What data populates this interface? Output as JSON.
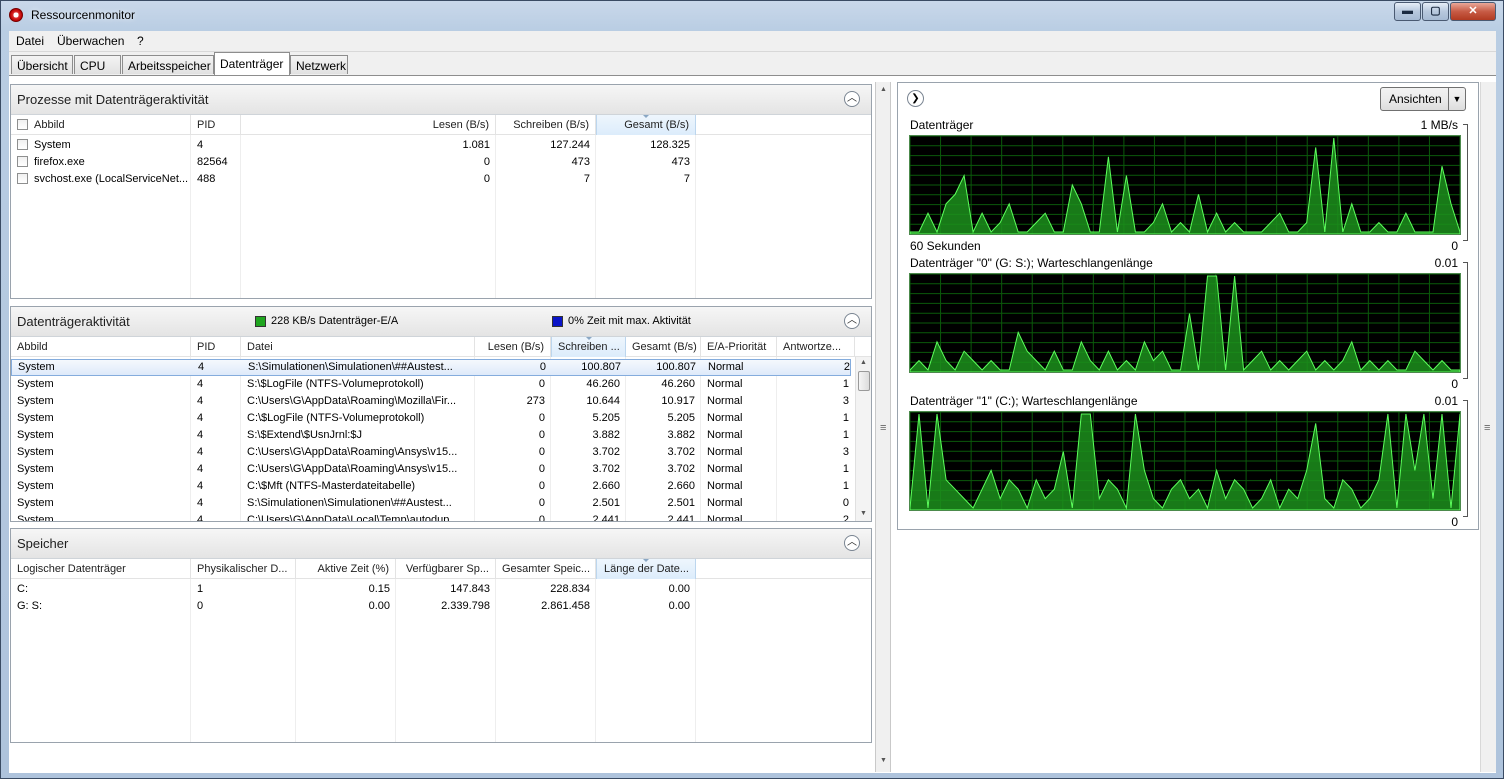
{
  "window": {
    "title": "Ressourcenmonitor",
    "min": "▬",
    "max": "▢",
    "close": "✕"
  },
  "menu": [
    "Datei",
    "Überwachen",
    "?"
  ],
  "tabs": [
    "Übersicht",
    "CPU",
    "Arbeitsspeicher",
    "Datenträger",
    "Netzwerk"
  ],
  "processes": {
    "title": "Prozesse mit Datenträgeraktivität",
    "columns": [
      "Abbild",
      "PID",
      "Lesen (B/s)",
      "Schreiben (B/s)",
      "Gesamt (B/s)"
    ],
    "rows": [
      [
        "System",
        "4",
        "1.081",
        "127.244",
        "128.325"
      ],
      [
        "firefox.exe",
        "82564",
        "0",
        "473",
        "473"
      ],
      [
        "svchost.exe (LocalServiceNet...",
        "488",
        "0",
        "7",
        "7"
      ]
    ]
  },
  "activity": {
    "title": "Datenträgeraktivität",
    "legend1": "228 KB/s Datenträger-E/A",
    "legend2": "0% Zeit mit max. Aktivität",
    "legend1_color": "#1fa51f",
    "legend2_color": "#0a14c8",
    "columns": [
      "Abbild",
      "PID",
      "Datei",
      "Lesen (B/s)",
      "Schreiben ...",
      "Gesamt (B/s)",
      "E/A-Priorität",
      "Antwortze..."
    ],
    "rows": [
      [
        "System",
        "4",
        "S:\\Simulationen\\Simulationen\\##Austest...",
        "0",
        "100.807",
        "100.807",
        "Normal",
        "2"
      ],
      [
        "System",
        "4",
        "S:\\$LogFile (NTFS-Volumeprotokoll)",
        "0",
        "46.260",
        "46.260",
        "Normal",
        "1"
      ],
      [
        "System",
        "4",
        "C:\\Users\\G\\AppData\\Roaming\\Mozilla\\Fir...",
        "273",
        "10.644",
        "10.917",
        "Normal",
        "3"
      ],
      [
        "System",
        "4",
        "C:\\$LogFile (NTFS-Volumeprotokoll)",
        "0",
        "5.205",
        "5.205",
        "Normal",
        "1"
      ],
      [
        "System",
        "4",
        "S:\\$Extend\\$UsnJrnl:$J",
        "0",
        "3.882",
        "3.882",
        "Normal",
        "1"
      ],
      [
        "System",
        "4",
        "C:\\Users\\G\\AppData\\Roaming\\Ansys\\v15...",
        "0",
        "3.702",
        "3.702",
        "Normal",
        "3"
      ],
      [
        "System",
        "4",
        "C:\\Users\\G\\AppData\\Roaming\\Ansys\\v15...",
        "0",
        "3.702",
        "3.702",
        "Normal",
        "1"
      ],
      [
        "System",
        "4",
        "C:\\$Mft (NTFS-Masterdateitabelle)",
        "0",
        "2.660",
        "2.660",
        "Normal",
        "1"
      ],
      [
        "System",
        "4",
        "S:\\Simulationen\\Simulationen\\##Austest...",
        "0",
        "2.501",
        "2.501",
        "Normal",
        "0"
      ],
      [
        "System",
        "4",
        "C:\\Users\\G\\AppData\\Local\\Temp\\autodup...",
        "0",
        "2.441",
        "2.441",
        "Normal",
        "2"
      ]
    ]
  },
  "storage": {
    "title": "Speicher",
    "columns": [
      "Logischer Datenträger",
      "Physikalischer D...",
      "Aktive Zeit (%)",
      "Verfügbarer Sp...",
      "Gesamter Speic...",
      "Länge der Date..."
    ],
    "rows": [
      [
        "C:",
        "1",
        "0.15",
        "147.843",
        "228.834",
        "0.00"
      ],
      [
        "G: S:",
        "0",
        "0.00",
        "2.339.798",
        "2.861.458",
        "0.00"
      ]
    ]
  },
  "right": {
    "views_label": "Ansichten",
    "graphs": [
      {
        "label": "Datenträger",
        "max": "1 MB/s",
        "footer_left": "60 Sekunden",
        "footer_right": "0"
      },
      {
        "label": "Datenträger \"0\" (G: S:); Warteschlangenlänge",
        "max": "0.01",
        "footer_left": "",
        "footer_right": "0"
      },
      {
        "label": "Datenträger \"1\" (C:); Warteschlangenlänge",
        "max": "0.01",
        "footer_left": "",
        "footer_right": "0"
      }
    ]
  }
}
